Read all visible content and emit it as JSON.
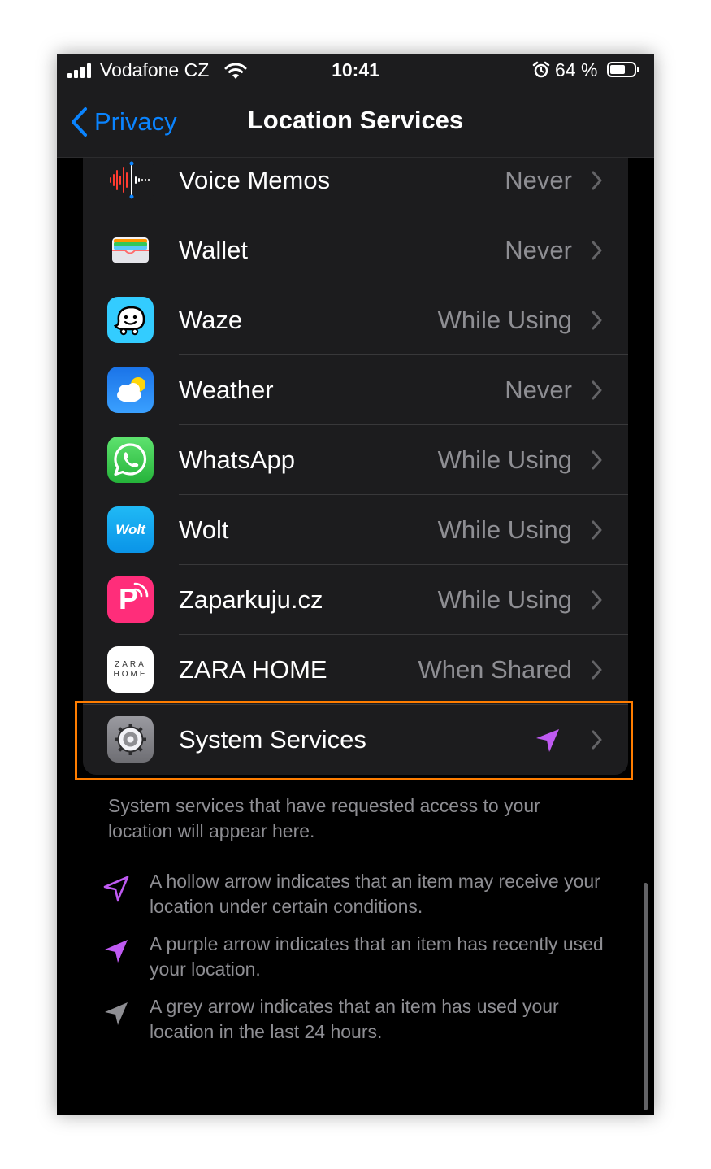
{
  "status_bar": {
    "carrier": "Vodafone CZ",
    "time": "10:41",
    "battery": "64 %"
  },
  "nav": {
    "back_label": "Privacy",
    "title": "Location Services"
  },
  "apps": [
    {
      "name": "Voice Memos",
      "value": "Never",
      "icon": "voice-memos-icon"
    },
    {
      "name": "Wallet",
      "value": "Never",
      "icon": "wallet-icon"
    },
    {
      "name": "Waze",
      "value": "While Using",
      "icon": "waze-icon"
    },
    {
      "name": "Weather",
      "value": "Never",
      "icon": "weather-icon"
    },
    {
      "name": "WhatsApp",
      "value": "While Using",
      "icon": "whatsapp-icon"
    },
    {
      "name": "Wolt",
      "value": "While Using",
      "icon": "wolt-icon",
      "icon_text": "Wolt"
    },
    {
      "name": "Zaparkuju.cz",
      "value": "While Using",
      "icon": "zaparkuju-icon",
      "icon_text": "P"
    },
    {
      "name": "ZARA HOME",
      "value": "When Shared",
      "icon": "zara-home-icon",
      "icon_text_1": "ZARA",
      "icon_text_2": "HOME"
    }
  ],
  "system_services": {
    "name": "System Services",
    "indicator": "purple-location-arrow-icon"
  },
  "footer_text": "System services that have requested access to your location will appear here.",
  "legend": [
    {
      "icon": "hollow-arrow-icon",
      "text": "A hollow arrow indicates that an item may receive your location under certain conditions."
    },
    {
      "icon": "purple-arrow-icon",
      "text": "A purple arrow indicates that an item has recently used your location."
    },
    {
      "icon": "grey-arrow-icon",
      "text": "A grey arrow indicates that an item has used your location in the last 24 hours."
    }
  ],
  "colors": {
    "accent_blue": "#0a84ff",
    "purple_arrow": "#bf5af2",
    "highlight_orange": "#ff7d00",
    "secondary_text": "#8e8e93"
  }
}
